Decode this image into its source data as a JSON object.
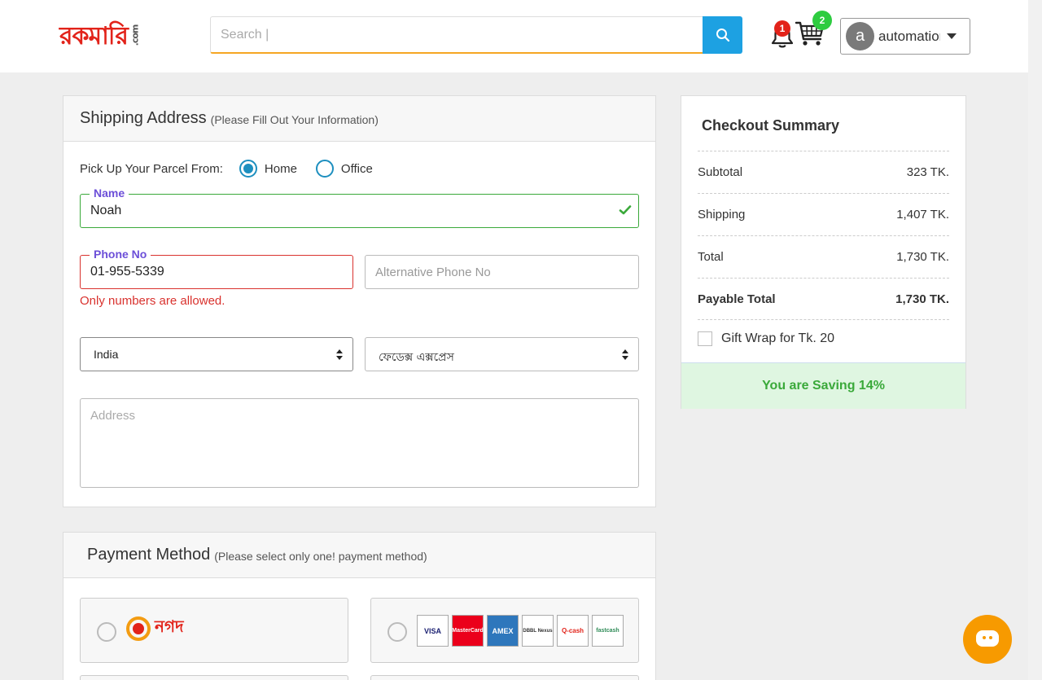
{
  "header": {
    "logo": {
      "main": "রকমারি",
      "suffix": ".com"
    },
    "search": {
      "placeholder": "Search |"
    },
    "notifications": {
      "count": "1"
    },
    "cart": {
      "count": "2"
    },
    "user": {
      "initial": "a",
      "name": "automation"
    }
  },
  "shipping": {
    "title": "Shipping Address",
    "subtitle": "(Please Fill Out Your Information)",
    "pickup_label": "Pick Up Your Parcel From:",
    "pickup_options": [
      {
        "label": "Home",
        "selected": true
      },
      {
        "label": "Office",
        "selected": false
      }
    ],
    "name": {
      "label": "Name",
      "value": "Noah"
    },
    "phone": {
      "label": "Phone No",
      "value": "01-955-5339",
      "error": "Only numbers are allowed."
    },
    "alt_phone": {
      "placeholder": "Alternative Phone No"
    },
    "country": {
      "value": "India"
    },
    "area": {
      "value": "ফেডেক্স এক্সপ্রেস"
    },
    "address": {
      "placeholder": "Address"
    }
  },
  "payment": {
    "title": "Payment Method",
    "subtitle": "(Please select only one! payment method)",
    "nagad_label": "নগদ",
    "card_brands": [
      "VISA",
      "MasterCard",
      "AMEX",
      "DBBL Nexus",
      "Q-cash",
      "fastcash"
    ]
  },
  "summary": {
    "title": "Checkout Summary",
    "rows": [
      {
        "label": "Subtotal",
        "value": "323 TK."
      },
      {
        "label": "Shipping",
        "value": "1,407 TK."
      },
      {
        "label": "Total",
        "value": "1,730 TK."
      },
      {
        "label": "Payable Total",
        "value": "1,730 TK."
      }
    ],
    "gift_wrap": "Gift Wrap for Tk. 20",
    "saving": "You are Saving 14%"
  },
  "colors": {
    "accent": "#1da1e2",
    "error": "#d9322e",
    "success": "#3aa93a",
    "chat": "#f79a00"
  }
}
